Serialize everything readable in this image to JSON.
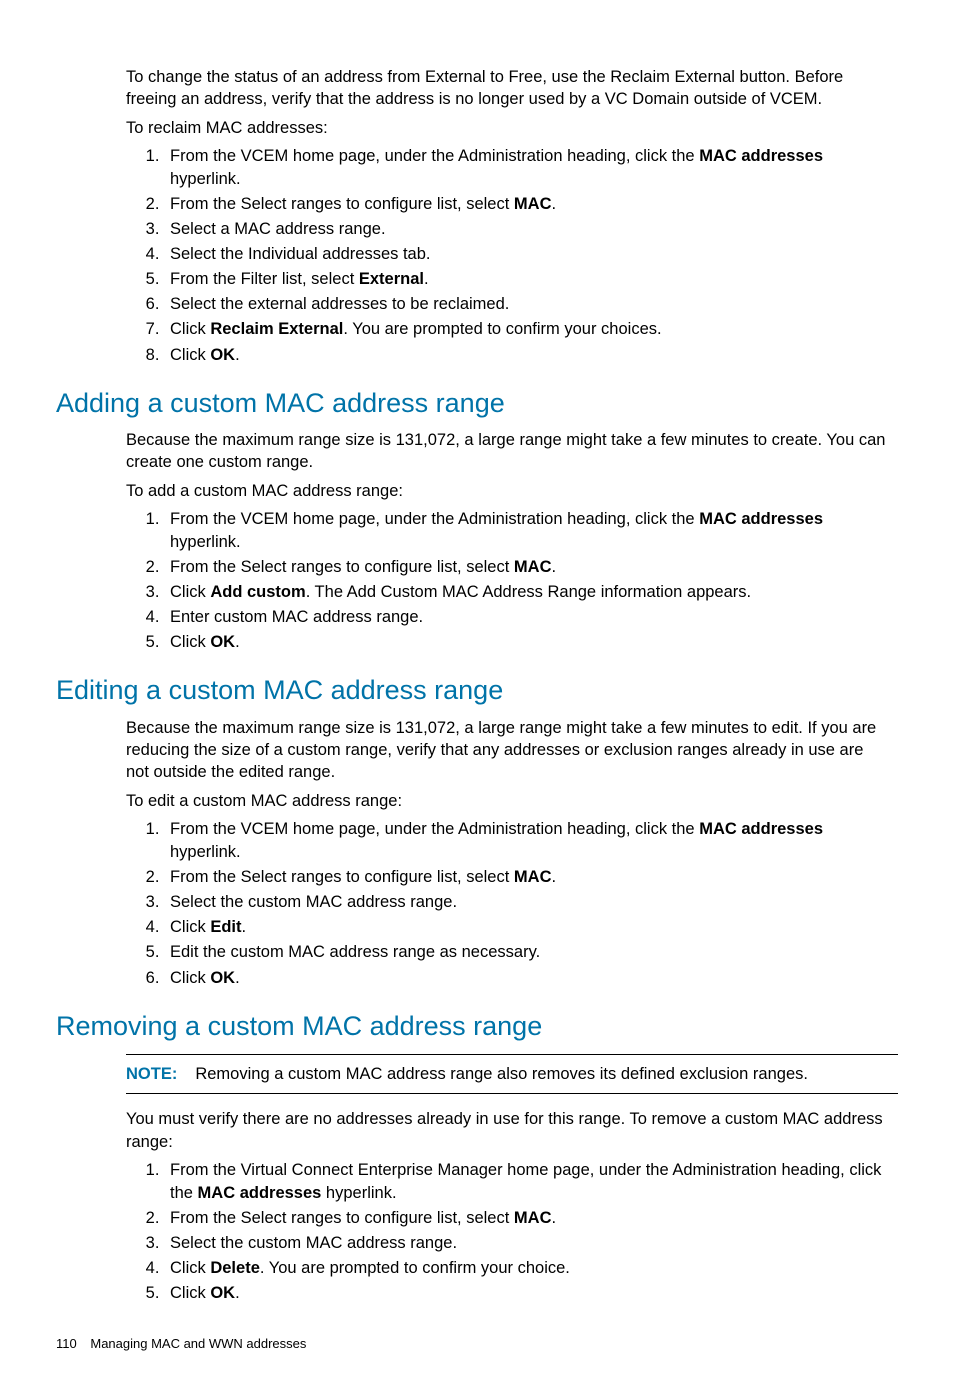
{
  "intro": {
    "p1": "To change the status of an address from External to Free, use the Reclaim External button. Before freeing an address, verify that the address is no longer used by a VC Domain outside of VCEM.",
    "p2": "To reclaim MAC addresses:",
    "steps": {
      "s1a": "From the VCEM home page, under the Administration heading, click the ",
      "s1b": "MAC addresses",
      "s1c": " hyperlink.",
      "s2a": "From the Select ranges to configure list, select ",
      "s2b": "MAC",
      "s2c": ".",
      "s3": "Select a MAC address range.",
      "s4": "Select the Individual addresses tab.",
      "s5a": "From the Filter list, select ",
      "s5b": "External",
      "s5c": ".",
      "s6": "Select the external addresses to be reclaimed.",
      "s7a": "Click ",
      "s7b": "Reclaim External",
      "s7c": ". You are prompted to confirm your choices.",
      "s8a": "Click ",
      "s8b": "OK",
      "s8c": "."
    }
  },
  "adding": {
    "heading": "Adding a custom MAC address range",
    "p1": "Because the maximum range size is 131,072, a large range might take a few minutes to create. You can create one custom range.",
    "p2": "To add a custom MAC address range:",
    "steps": {
      "s1a": "From the VCEM home page, under the Administration heading, click the ",
      "s1b": "MAC addresses",
      "s1c": " hyperlink.",
      "s2a": "From the Select ranges to configure list, select ",
      "s2b": "MAC",
      "s2c": ".",
      "s3a": "Click ",
      "s3b": "Add custom",
      "s3c": ". The Add Custom MAC Address Range information appears.",
      "s4": "Enter custom MAC address range.",
      "s5a": "Click ",
      "s5b": "OK",
      "s5c": "."
    }
  },
  "editing": {
    "heading": "Editing a custom MAC address range",
    "p1": "Because the maximum range size is 131,072, a large range might take a few minutes to edit. If you are reducing the size of a custom range, verify that any addresses or exclusion ranges already in use are not outside the edited range.",
    "p2": "To edit a custom MAC address range:",
    "steps": {
      "s1a": "From the VCEM home page, under the Administration heading, click the ",
      "s1b": "MAC addresses",
      "s1c": " hyperlink.",
      "s2a": "From the Select ranges to configure list, select ",
      "s2b": "MAC",
      "s2c": ".",
      "s3": "Select the custom MAC address range.",
      "s4a": "Click ",
      "s4b": "Edit",
      "s4c": ".",
      "s5": "Edit the custom MAC address range as necessary.",
      "s6a": "Click ",
      "s6b": "OK",
      "s6c": "."
    }
  },
  "removing": {
    "heading": "Removing a custom MAC address range",
    "note_label": "NOTE:",
    "note_text": "Removing a custom MAC address range also removes its defined exclusion ranges.",
    "p1": "You must verify there are no addresses already in use for this range. To remove a custom MAC address range:",
    "steps": {
      "s1a": "From the Virtual Connect Enterprise Manager home page, under the Administration heading, click the ",
      "s1b": "MAC addresses",
      "s1c": " hyperlink.",
      "s2a": "From the Select ranges to configure list, select ",
      "s2b": "MAC",
      "s2c": ".",
      "s3": "Select the custom MAC address range.",
      "s4a": "Click ",
      "s4b": "Delete",
      "s4c": ". You are prompted to confirm your choice.",
      "s5a": "Click ",
      "s5b": "OK",
      "s5c": "."
    }
  },
  "footer": {
    "page_no": "110",
    "title": "Managing MAC and WWN addresses"
  }
}
